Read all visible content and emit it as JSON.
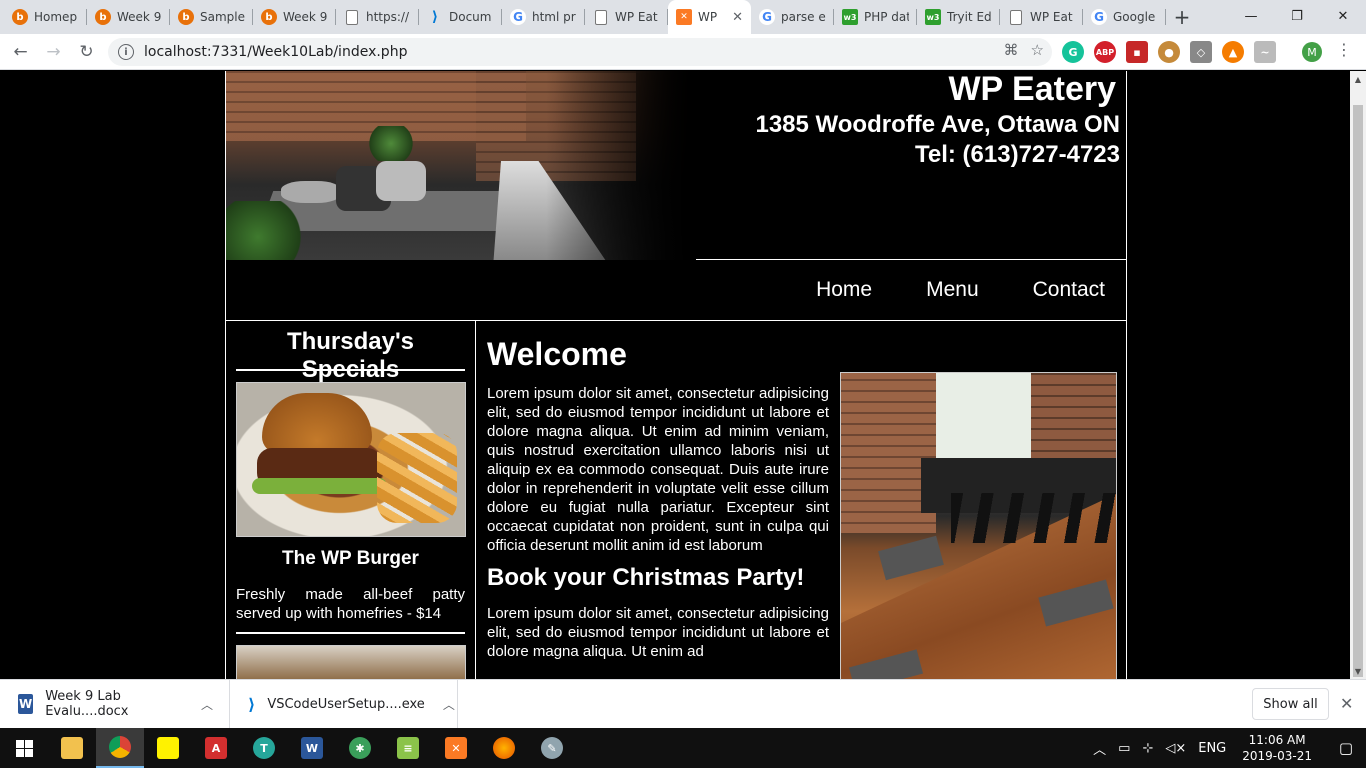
{
  "browser": {
    "tabs": [
      {
        "label": "Homep",
        "favicon": "b"
      },
      {
        "label": "Week 9",
        "favicon": "b"
      },
      {
        "label": "Sample",
        "favicon": "b"
      },
      {
        "label": "Week 9",
        "favicon": "b"
      },
      {
        "label": "https://",
        "favicon": "doc"
      },
      {
        "label": "Docum",
        "favicon": "vs"
      },
      {
        "label": "html pr",
        "favicon": "g"
      },
      {
        "label": "WP Eat",
        "favicon": "doc"
      },
      {
        "label": "WP",
        "favicon": "xm",
        "active": true
      },
      {
        "label": "parse e",
        "favicon": "g"
      },
      {
        "label": "PHP dat",
        "favicon": "w3"
      },
      {
        "label": "Tryit Ed",
        "favicon": "w3"
      },
      {
        "label": "WP Eat",
        "favicon": "doc"
      },
      {
        "label": "Google",
        "favicon": "g"
      }
    ],
    "close_glyph": "✕",
    "newtab_glyph": "+",
    "url": "localhost:7331/Week10Lab/index.php",
    "profile_initial": "M"
  },
  "site": {
    "name": "WP Eatery",
    "address": "1385 Woodroffe Ave, Ottawa ON",
    "phone": "Tel: (613)727-4723",
    "nav": {
      "home": "Home",
      "menu": "Menu",
      "contact": "Contact"
    },
    "sidebar": {
      "title": "Thursday's Specials",
      "item_name": "The WP Burger",
      "item_desc": "Freshly made all-beef patty served up with homefries - $14"
    },
    "main": {
      "welcome": "Welcome",
      "para1": "Lorem ipsum dolor sit amet, consectetur adipisicing elit, sed do eiusmod tempor incididunt ut labore et dolore magna aliqua. Ut enim ad minim veniam, quis nostrud exercitation ullamco laboris nisi ut aliquip ex ea commodo consequat. Duis aute irure dolor in reprehenderit in voluptate velit esse cillum dolore eu fugiat nulla pariatur. Excepteur sint occaecat cupidatat non proident, sunt in culpa qui officia deserunt mollit anim id est laborum",
      "subheading": "Book your Christmas Party!",
      "para2": "Lorem ipsum dolor sit amet, consectetur adipisicing elit, sed do eiusmod tempor incididunt ut labore et dolore magna aliqua. Ut enim ad"
    }
  },
  "downloads": {
    "items": [
      {
        "name": "Week 9 Lab Evalu....docx",
        "icon": "word-icon"
      },
      {
        "name": "VSCodeUserSetup....exe",
        "icon": "vscode-icon"
      }
    ],
    "show_all": "Show all"
  },
  "taskbar": {
    "language": "ENG",
    "time": "11:06 AM",
    "date": "2019-03-21"
  }
}
